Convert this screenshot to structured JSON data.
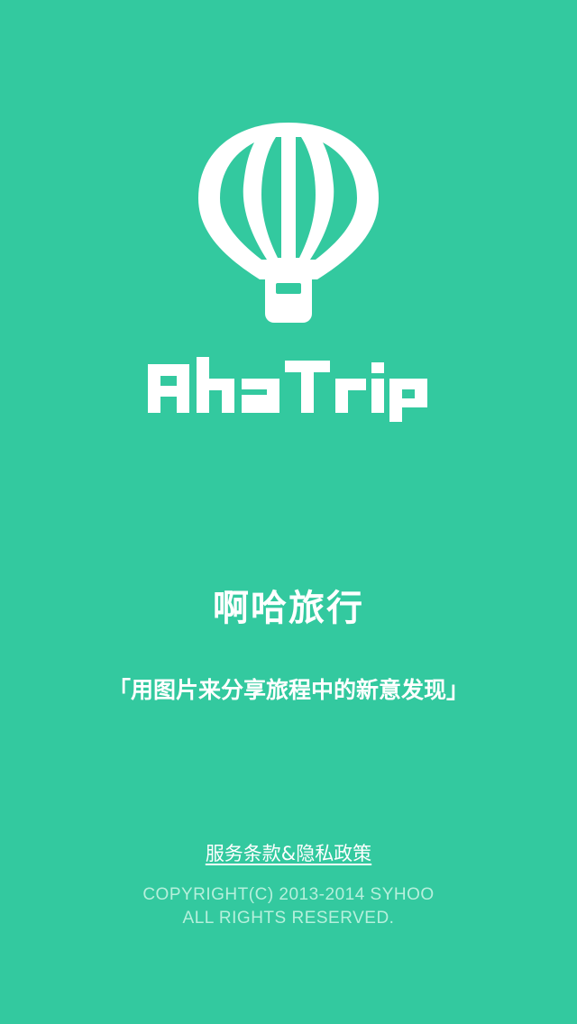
{
  "colors": {
    "background": "#33c99f",
    "foreground": "#ffffff",
    "copyright_text": "#b6f0dc"
  },
  "logo": {
    "icon": "hot-air-balloon-icon",
    "wordmark": "AhaTrip"
  },
  "app_name": "啊哈旅行",
  "tagline": "「用图片来分享旅程中的新意发现」",
  "footer": {
    "terms_link": "服务条款&隐私政策",
    "copyright_line1": "COPYRIGHT(C) 2013-2014 SYHOO",
    "copyright_line2": "ALL RIGHTS RESERVED."
  }
}
